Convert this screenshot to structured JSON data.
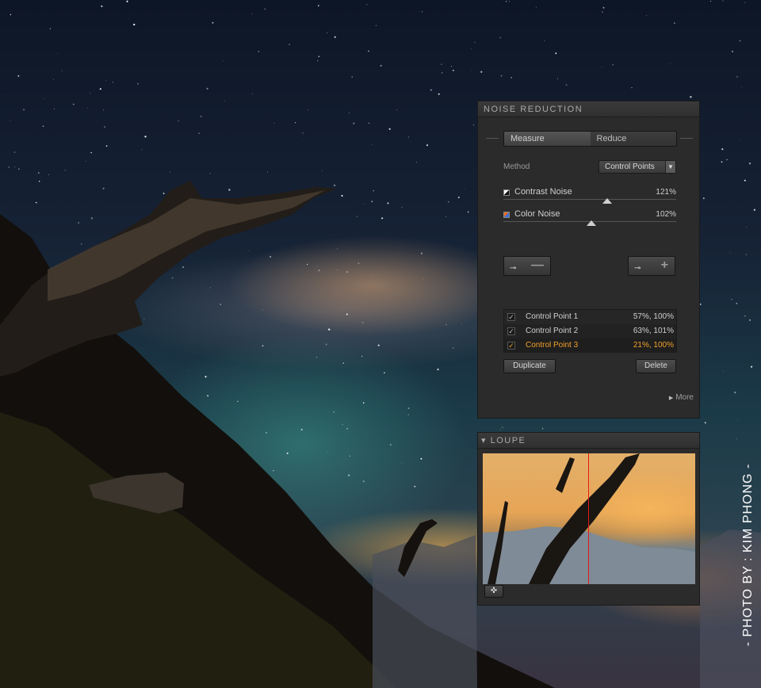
{
  "noise_reduction": {
    "title": "NOISE REDUCTION",
    "tabs": [
      {
        "label": "Measure",
        "active": true
      },
      {
        "label": "Reduce",
        "active": false
      }
    ],
    "method_label": "Method",
    "method_value": "Control Points",
    "contrast_noise": {
      "label": "Contrast Noise",
      "value": "121%",
      "level": 1.21
    },
    "color_noise": {
      "label": "Color Noise",
      "value": "102%",
      "level": 1.02
    },
    "control_points": [
      {
        "name": "Control Point 1",
        "values": "57%, 100%",
        "checked": true,
        "selected": false
      },
      {
        "name": "Control Point 2",
        "values": "63%, 101%",
        "checked": true,
        "selected": false
      },
      {
        "name": "Control Point 3",
        "values": "21%, 100%",
        "checked": true,
        "selected": true
      }
    ],
    "duplicate_label": "Duplicate",
    "delete_label": "Delete",
    "more_label": "More",
    "check_mark": "✓",
    "minus_glyph": "—",
    "plus_glyph": "+",
    "pin_glyph": "⊸",
    "dropdown_glyph": "▼"
  },
  "loupe": {
    "title": "LOUPE",
    "collapse_glyph": "▾",
    "pin_tool_glyph": "✜"
  },
  "credit": "- PHOTO BY : KIM PHONG -",
  "colors": {
    "selected_item": "#f1a12a",
    "loupe_split_line": "#e11a1a",
    "panel_bg": "#2b2b2b"
  }
}
